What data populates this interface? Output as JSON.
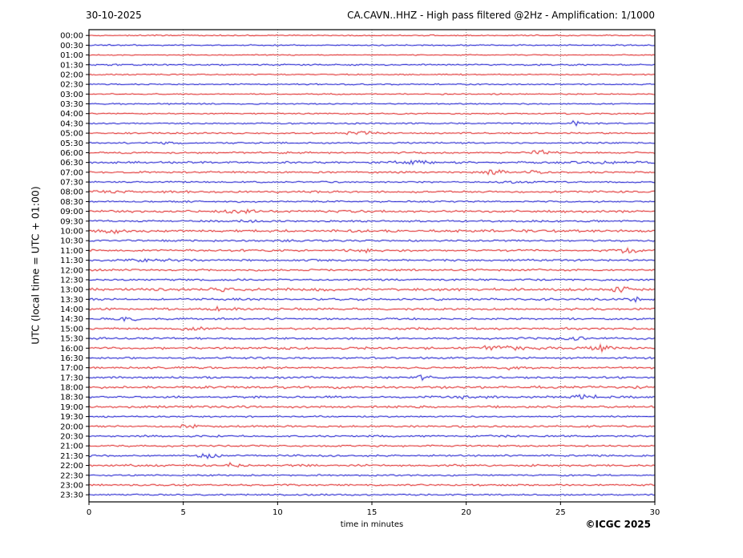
{
  "figure": {
    "date_label": "30-10-2025",
    "title": "CA.CAVN..HHZ - High pass filtered @2Hz - Amplification: 1/1000",
    "ylabel": "UTC (local time = UTC + 01:00)",
    "xlabel": "time in minutes",
    "credit": "©ICGC 2025"
  },
  "chart_data": {
    "type": "line",
    "subtype": "helicorder-daily-seismogram",
    "title": "CA.CAVN..HHZ - High pass filtered @2Hz - Amplification: 1/1000",
    "date": "30-10-2025",
    "station": "CA.CAVN..HHZ",
    "filter": "High pass filtered @2Hz",
    "amplification": "1/1000",
    "xlabel": "time in minutes",
    "ylabel": "UTC (local time = UTC + 01:00)",
    "xlim": [
      0,
      30
    ],
    "x_ticks": [
      0,
      5,
      10,
      15,
      20,
      25,
      30
    ],
    "row_interval_minutes": 30,
    "grid": "vertical dotted lines at 5-minute intervals",
    "legend": "none",
    "colors": {
      "hour_row": "#e03030",
      "half_hour_row": "#2525d0",
      "grid": "#666666",
      "frame": "#000000"
    },
    "rows": [
      {
        "label": "00:00",
        "color": "red",
        "noise": 0.45,
        "events": []
      },
      {
        "label": "00:30",
        "color": "blue",
        "noise": 0.5,
        "events": []
      },
      {
        "label": "01:00",
        "color": "red",
        "noise": 0.4,
        "events": []
      },
      {
        "label": "01:30",
        "color": "blue",
        "noise": 0.55,
        "events": []
      },
      {
        "label": "02:00",
        "color": "red",
        "noise": 0.45,
        "events": []
      },
      {
        "label": "02:30",
        "color": "blue",
        "noise": 0.5,
        "events": []
      },
      {
        "label": "03:00",
        "color": "red",
        "noise": 0.45,
        "events": []
      },
      {
        "label": "03:30",
        "color": "blue",
        "noise": 0.5,
        "events": []
      },
      {
        "label": "04:00",
        "color": "red",
        "noise": 0.5,
        "events": []
      },
      {
        "label": "04:30",
        "color": "blue",
        "noise": 0.55,
        "events": [
          [
            25.8,
            0.6,
            1.4
          ]
        ]
      },
      {
        "label": "05:00",
        "color": "red",
        "noise": 0.6,
        "events": [
          [
            14.5,
            1.2,
            1.1
          ]
        ]
      },
      {
        "label": "05:30",
        "color": "blue",
        "noise": 0.6,
        "events": [
          [
            4.0,
            0.8,
            0.7
          ]
        ]
      },
      {
        "label": "06:00",
        "color": "red",
        "noise": 0.65,
        "events": [
          [
            24.0,
            1.0,
            1.4
          ]
        ]
      },
      {
        "label": "06:30",
        "color": "blue",
        "noise": 0.75,
        "events": [
          [
            17.0,
            1.5,
            1.2
          ],
          [
            27.5,
            2.0,
            0.7
          ]
        ]
      },
      {
        "label": "07:00",
        "color": "red",
        "noise": 0.7,
        "events": [
          [
            21.5,
            0.8,
            1.1
          ],
          [
            23.7,
            0.8,
            1.3
          ]
        ]
      },
      {
        "label": "07:30",
        "color": "blue",
        "noise": 0.6,
        "events": [
          [
            22.5,
            1.0,
            0.6
          ]
        ]
      },
      {
        "label": "08:00",
        "color": "red",
        "noise": 0.8,
        "events": [
          [
            0.9,
            0.6,
            1.5
          ]
        ]
      },
      {
        "label": "08:30",
        "color": "blue",
        "noise": 0.6,
        "events": []
      },
      {
        "label": "09:00",
        "color": "red",
        "noise": 0.9,
        "events": [
          [
            8.0,
            1.5,
            0.8
          ]
        ]
      },
      {
        "label": "09:30",
        "color": "blue",
        "noise": 0.7,
        "events": [
          [
            8.5,
            1.0,
            0.6
          ]
        ]
      },
      {
        "label": "10:00",
        "color": "red",
        "noise": 0.9,
        "events": [
          [
            1.3,
            0.8,
            1.4
          ],
          [
            23.7,
            1.5,
            0.9
          ]
        ]
      },
      {
        "label": "10:30",
        "color": "blue",
        "noise": 0.7,
        "events": []
      },
      {
        "label": "11:00",
        "color": "red",
        "noise": 0.8,
        "events": [
          [
            14.6,
            0.8,
            1.2
          ],
          [
            28.6,
            0.8,
            1.7
          ]
        ]
      },
      {
        "label": "11:30",
        "color": "blue",
        "noise": 0.75,
        "events": [
          [
            3.5,
            1.5,
            0.7
          ]
        ]
      },
      {
        "label": "12:00",
        "color": "red",
        "noise": 0.7,
        "events": []
      },
      {
        "label": "12:30",
        "color": "blue",
        "noise": 0.7,
        "events": []
      },
      {
        "label": "13:00",
        "color": "red",
        "noise": 1.0,
        "events": [
          [
            7.3,
            1.2,
            1.1
          ],
          [
            28.3,
            0.6,
            1.7
          ]
        ]
      },
      {
        "label": "13:30",
        "color": "blue",
        "noise": 0.8,
        "events": [
          [
            29.0,
            0.8,
            1.1
          ]
        ]
      },
      {
        "label": "14:00",
        "color": "red",
        "noise": 0.85,
        "events": [
          [
            7.1,
            0.7,
            1.7
          ]
        ]
      },
      {
        "label": "14:30",
        "color": "blue",
        "noise": 0.7,
        "events": [
          [
            2.0,
            0.8,
            1.3
          ]
        ]
      },
      {
        "label": "15:00",
        "color": "red",
        "noise": 0.8,
        "events": [
          [
            5.6,
            0.9,
            1.4
          ]
        ]
      },
      {
        "label": "15:30",
        "color": "blue",
        "noise": 0.75,
        "events": [
          [
            25.7,
            1.0,
            1.3
          ]
        ]
      },
      {
        "label": "16:00",
        "color": "red",
        "noise": 0.9,
        "events": [
          [
            21.8,
            1.8,
            1.4
          ],
          [
            27.2,
            1.0,
            1.6
          ]
        ]
      },
      {
        "label": "16:30",
        "color": "blue",
        "noise": 0.7,
        "events": []
      },
      {
        "label": "17:00",
        "color": "red",
        "noise": 0.8,
        "events": [
          [
            22.3,
            0.9,
            1.5
          ]
        ]
      },
      {
        "label": "17:30",
        "color": "blue",
        "noise": 0.75,
        "events": [
          [
            18.0,
            1.0,
            1.4
          ]
        ]
      },
      {
        "label": "18:00",
        "color": "red",
        "noise": 0.9,
        "events": []
      },
      {
        "label": "18:30",
        "color": "blue",
        "noise": 0.8,
        "events": [
          [
            20.0,
            1.2,
            0.9
          ],
          [
            26.3,
            1.2,
            1.2
          ]
        ]
      },
      {
        "label": "19:00",
        "color": "red",
        "noise": 0.8,
        "events": []
      },
      {
        "label": "19:30",
        "color": "blue",
        "noise": 0.6,
        "events": []
      },
      {
        "label": "20:00",
        "color": "red",
        "noise": 0.75,
        "events": [
          [
            5.4,
            0.6,
            1.7
          ]
        ]
      },
      {
        "label": "20:30",
        "color": "blue",
        "noise": 0.7,
        "events": []
      },
      {
        "label": "21:00",
        "color": "red",
        "noise": 0.7,
        "events": []
      },
      {
        "label": "21:30",
        "color": "blue",
        "noise": 0.7,
        "events": [
          [
            6.4,
            0.9,
            1.2
          ]
        ]
      },
      {
        "label": "22:00",
        "color": "red",
        "noise": 0.8,
        "events": [
          [
            7.5,
            0.7,
            1.2
          ]
        ]
      },
      {
        "label": "22:30",
        "color": "blue",
        "noise": 0.6,
        "events": []
      },
      {
        "label": "23:00",
        "color": "red",
        "noise": 0.7,
        "events": []
      },
      {
        "label": "23:30",
        "color": "blue",
        "noise": 0.6,
        "events": []
      }
    ]
  }
}
